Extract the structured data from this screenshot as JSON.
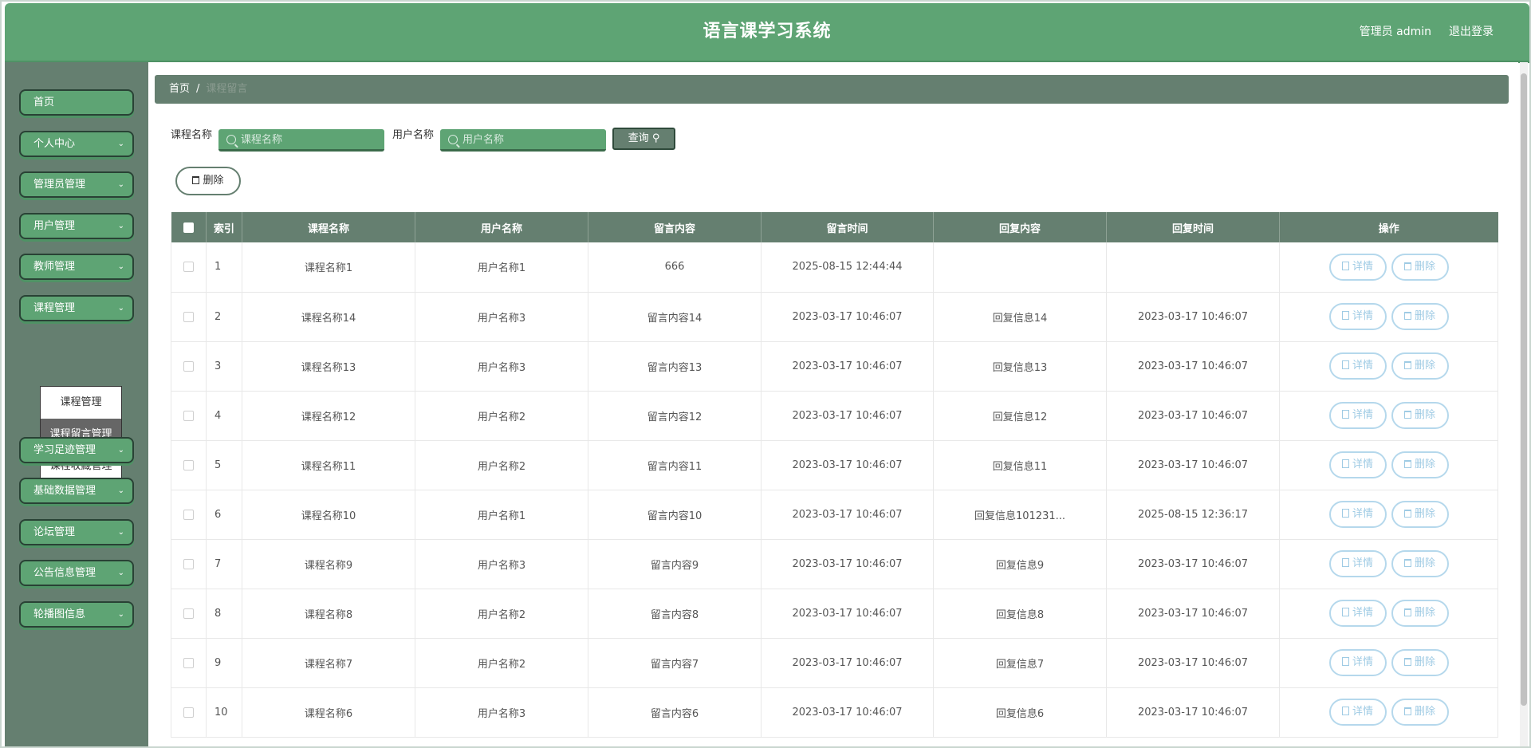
{
  "header": {
    "title": "语言课学习系统",
    "user_label": "管理员 admin",
    "logout_label": "退出登录"
  },
  "sidebar": {
    "items": [
      {
        "label": "首页",
        "has_chevron": false
      },
      {
        "label": "个人中心",
        "has_chevron": true
      },
      {
        "label": "管理员管理",
        "has_chevron": true
      },
      {
        "label": "用户管理",
        "has_chevron": true
      },
      {
        "label": "教师管理",
        "has_chevron": true
      },
      {
        "label": "课程管理",
        "has_chevron": true
      },
      {
        "label": "学习足迹管理",
        "has_chevron": true
      },
      {
        "label": "基础数据管理",
        "has_chevron": true
      },
      {
        "label": "论坛管理",
        "has_chevron": true
      },
      {
        "label": "公告信息管理",
        "has_chevron": true
      },
      {
        "label": "轮播图信息",
        "has_chevron": true
      }
    ],
    "submenu": [
      {
        "label": "课程管理",
        "active": false
      },
      {
        "label": "课程留言管理",
        "active": true
      },
      {
        "label": "课程收藏管理",
        "active": false
      }
    ]
  },
  "breadcrumb": {
    "home": "首页",
    "separator": "/",
    "current": "课程留言"
  },
  "search": {
    "course_label": "课程名称",
    "course_placeholder": "课程名称",
    "user_label": "用户名称",
    "user_placeholder": "用户名称",
    "query_label": "查询"
  },
  "toolbar": {
    "delete_label": "删除"
  },
  "table": {
    "columns": [
      "索引",
      "课程名称",
      "用户名称",
      "留言内容",
      "留言时间",
      "回复内容",
      "回复时间",
      "操作"
    ],
    "detail_label": "详情",
    "delete_label": "删除",
    "rows": [
      [
        "1",
        "课程名称1",
        "用户名称1",
        "666",
        "2025-08-15 12:44:44",
        "",
        ""
      ],
      [
        "2",
        "课程名称14",
        "用户名称3",
        "留言内容14",
        "2023-03-17 10:46:07",
        "回复信息14",
        "2023-03-17 10:46:07"
      ],
      [
        "3",
        "课程名称13",
        "用户名称3",
        "留言内容13",
        "2023-03-17 10:46:07",
        "回复信息13",
        "2023-03-17 10:46:07"
      ],
      [
        "4",
        "课程名称12",
        "用户名称2",
        "留言内容12",
        "2023-03-17 10:46:07",
        "回复信息12",
        "2023-03-17 10:46:07"
      ],
      [
        "5",
        "课程名称11",
        "用户名称2",
        "留言内容11",
        "2023-03-17 10:46:07",
        "回复信息11",
        "2023-03-17 10:46:07"
      ],
      [
        "6",
        "课程名称10",
        "用户名称1",
        "留言内容10",
        "2023-03-17 10:46:07",
        "回复信息101231...",
        "2025-08-15 12:36:17"
      ],
      [
        "7",
        "课程名称9",
        "用户名称3",
        "留言内容9",
        "2023-03-17 10:46:07",
        "回复信息9",
        "2023-03-17 10:46:07"
      ],
      [
        "8",
        "课程名称8",
        "用户名称2",
        "留言内容8",
        "2023-03-17 10:46:07",
        "回复信息8",
        "2023-03-17 10:46:07"
      ],
      [
        "9",
        "课程名称7",
        "用户名称2",
        "留言内容7",
        "2023-03-17 10:46:07",
        "回复信息7",
        "2023-03-17 10:46:07"
      ],
      [
        "10",
        "课程名称6",
        "用户名称3",
        "留言内容6",
        "2023-03-17 10:46:07",
        "回复信息6",
        "2023-03-17 10:46:07"
      ]
    ]
  },
  "colors": {
    "header_green": "#5ea474",
    "sidebar_gray_green": "#657f70",
    "action_blue": "#9fcbe4"
  },
  "icons": {
    "search": "search-icon",
    "trash": "trash-icon",
    "detail": "document-icon",
    "chevron": "chevron-down-icon"
  }
}
